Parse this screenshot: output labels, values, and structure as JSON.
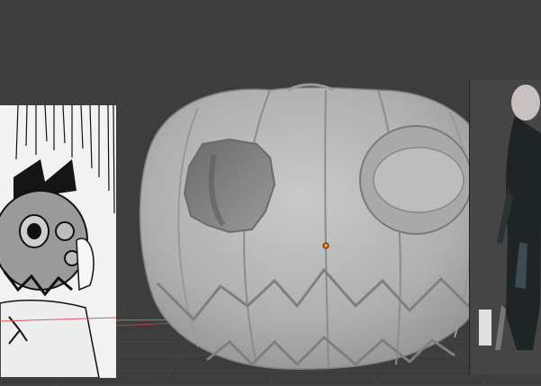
{
  "viewport": {
    "background": "#3d3d3d",
    "grid_visible": true,
    "axis_x_color": "#a84848",
    "axis_y_color": "#7a9a3a",
    "origin_marker_color": "#ff8a1e"
  },
  "reference_left": {
    "icon": "manga-pumpkin-mask-icon"
  },
  "reference_right": {
    "icon": "dark-character-figure-icon"
  },
  "pumpkin_mesh": {
    "icon": "sculpted-pumpkin-icon",
    "color": "#b3b3b3"
  },
  "cursor_3d": {
    "icon": "3d-cursor-icon"
  }
}
